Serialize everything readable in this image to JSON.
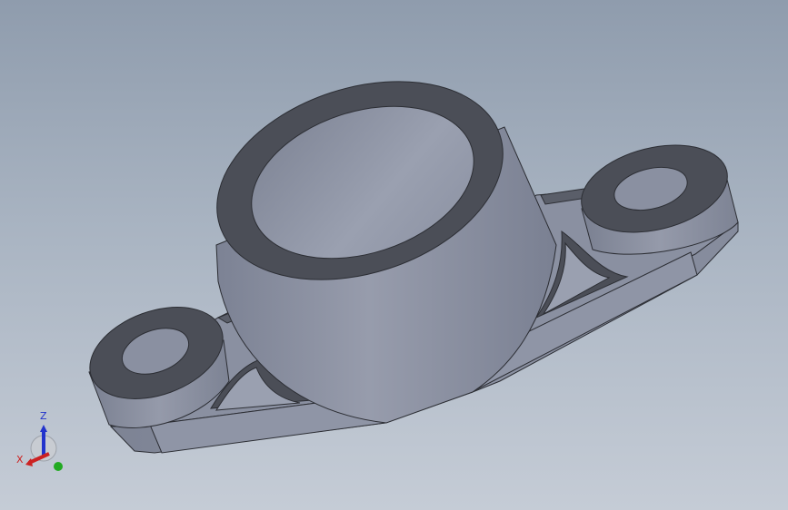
{
  "viewport": {
    "background_top": "#8f9cad",
    "background_bottom": "#c5ccd6"
  },
  "model": {
    "part_color": "#878ea0",
    "face_dark_color": "#4b4e57",
    "shadow_color": "#5b5f6a"
  },
  "triad": {
    "x_label": "X",
    "z_label": "Z",
    "x_color": "#cc2222",
    "y_color": "#22aa22",
    "z_color": "#2233cc"
  }
}
